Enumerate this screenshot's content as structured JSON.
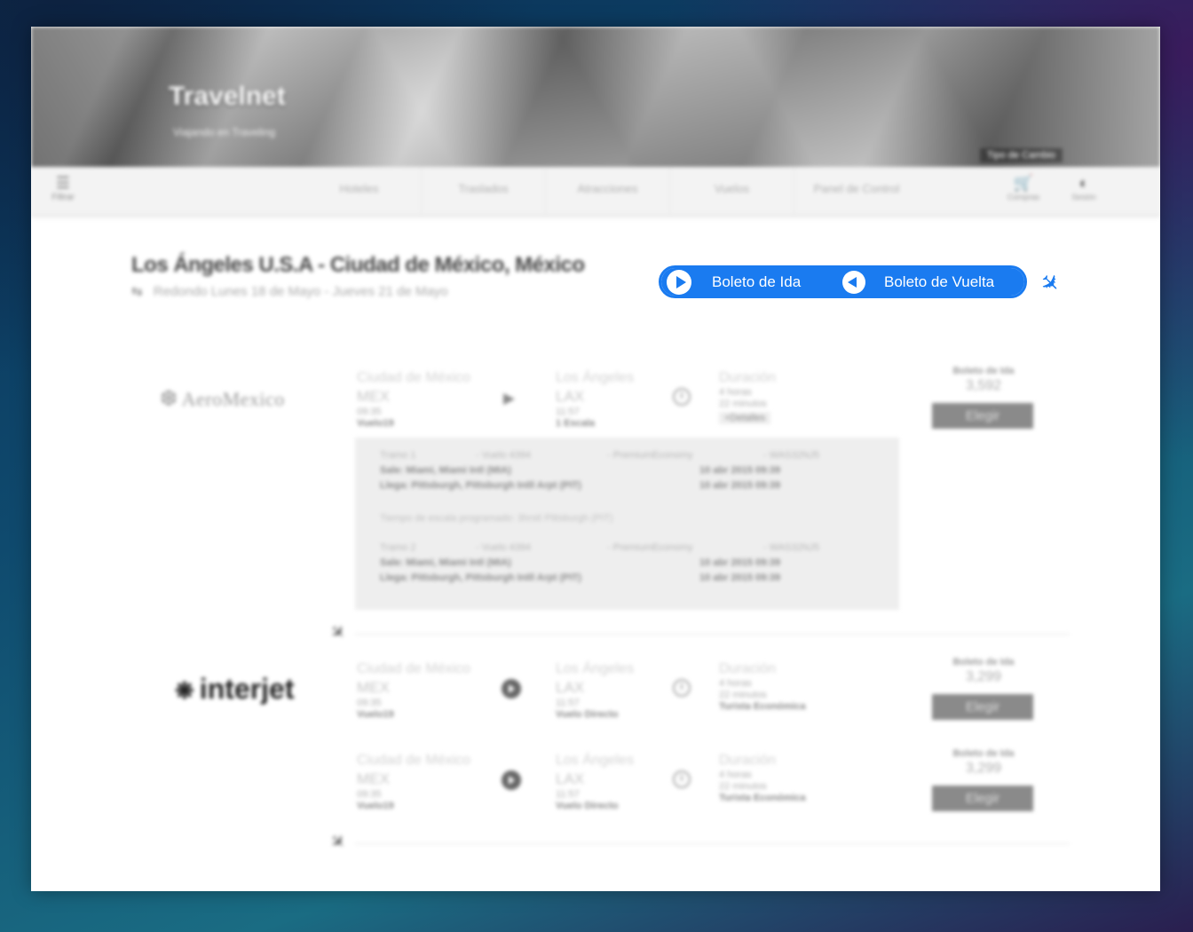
{
  "header": {
    "brand": "Travelnet",
    "tagline": "Viajando en Traveling",
    "currency_label": "Tipo de Cambio"
  },
  "nav": {
    "filter_label": "Filtrar",
    "links": [
      "Hoteles",
      "Traslados",
      "Atracciones",
      "Vuelos",
      "Panel de Control"
    ],
    "cart_label": "Compras",
    "session_label": "Sesión"
  },
  "route": {
    "title": "Los Ángeles U.S.A - Ciudad de México, México",
    "subtitle": "Redondo Lunes 18 de Mayo - Jueves 21 de Mayo"
  },
  "toggle": {
    "outbound_label": "Boleto de Ida",
    "return_label": "Boleto de Vuelta",
    "accent_color": "#1a7bf0"
  },
  "airlines": {
    "aeromexico": "AeroMexico",
    "interjet": "interjet"
  },
  "flights": [
    {
      "origin_city": "Ciudad de México",
      "origin_code": "MEX",
      "depart": "09:35",
      "flight": "Vuelo19",
      "dest_city": "Los Ángeles",
      "dest_code": "LAX",
      "arrive": "11:57",
      "stops": "1 Escala",
      "duration_label": "Duración",
      "duration_h": "4 horas",
      "duration_m": "22 minutos",
      "extra": "+Detalles",
      "price_label": "Boleto de Ida",
      "price": "3,592",
      "button": "Elegir"
    },
    {
      "origin_city": "Ciudad de México",
      "origin_code": "MEX",
      "depart": "09:35",
      "flight": "Vuelo19",
      "dest_city": "Los Ángeles",
      "dest_code": "LAX",
      "arrive": "11:57",
      "stops": "Vuelo Directo",
      "duration_label": "Duración",
      "duration_h": "4 horas",
      "duration_m": "22 minutos",
      "extra": "Turista Económica",
      "price_label": "Boleto de Ida",
      "price": "3,299",
      "button": "Elegir"
    },
    {
      "origin_city": "Ciudad de México",
      "origin_code": "MEX",
      "depart": "09:35",
      "flight": "Vuelo19",
      "dest_city": "Los Ángeles",
      "dest_code": "LAX",
      "arrive": "11:57",
      "stops": "Vuelo Directo",
      "duration_label": "Duración",
      "duration_h": "4 horas",
      "duration_m": "22 minutos",
      "extra": "Turista Económica",
      "price_label": "Boleto de Ida",
      "price": "3,299",
      "button": "Elegir"
    }
  ],
  "details": {
    "tramos": [
      {
        "tramo": "Tramo 1",
        "vuelo": "- Vuelo 4394",
        "clase": "- PremiumEconomy",
        "codigo": "- WAS32NJ5",
        "sale": "Sale: Miami, Miami Intl (MIA)",
        "sale_time": "10 abr 2015 09:39",
        "llega": "Llega: Pittsburgh, Pittsburgh Intll Arpt (PIT)",
        "llega_time": "10 abr 2015 09:39"
      },
      {
        "tramo": "Tramo 2",
        "vuelo": "- Vuelo 4394",
        "clase": "- PremiumEconomy",
        "codigo": "- WAS32NJ5",
        "sale": "Sale: Miami, Miami Intl (MIA)",
        "sale_time": "10 abr 2015 09:39",
        "llega": "Llega: Pittsburgh, Pittsburgh Intll Arpt (PIT)",
        "llega_time": "10 abr 2015 09:39"
      }
    ],
    "escala": "Tiempo de escala programado: 3hrs6 Pittsburgh (PIT)"
  }
}
